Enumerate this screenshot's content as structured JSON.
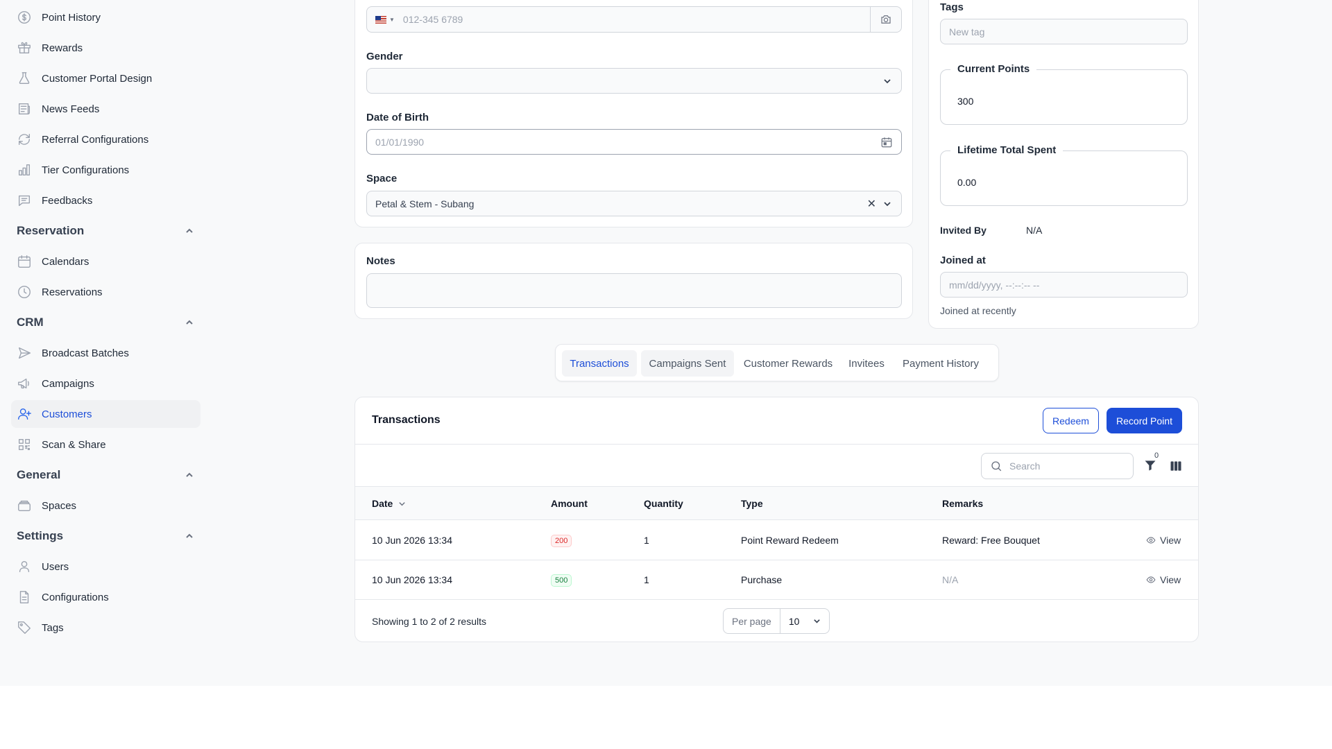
{
  "sidebar": {
    "items_top": [
      {
        "label": "Point History",
        "icon": "dollar-circle-icon"
      },
      {
        "label": "Rewards",
        "icon": "gift-icon"
      },
      {
        "label": "Customer Portal Design",
        "icon": "flask-icon"
      },
      {
        "label": "News Feeds",
        "icon": "newspaper-icon"
      },
      {
        "label": "Referral Configurations",
        "icon": "refresh-icon"
      },
      {
        "label": "Tier Configurations",
        "icon": "bar-chart-icon"
      },
      {
        "label": "Feedbacks",
        "icon": "chat-icon"
      }
    ],
    "groups": {
      "reservation": {
        "label": "Reservation",
        "items": [
          {
            "label": "Calendars"
          },
          {
            "label": "Reservations"
          }
        ]
      },
      "crm": {
        "label": "CRM",
        "items": [
          {
            "label": "Broadcast Batches"
          },
          {
            "label": "Campaigns"
          },
          {
            "label": "Customers"
          },
          {
            "label": "Scan & Share"
          }
        ]
      },
      "general": {
        "label": "General",
        "items": [
          {
            "label": "Spaces"
          }
        ]
      },
      "settings": {
        "label": "Settings",
        "items": [
          {
            "label": "Users"
          },
          {
            "label": "Configurations"
          },
          {
            "label": "Tags"
          }
        ]
      }
    },
    "active_item": "Customers"
  },
  "form": {
    "phone": {
      "placeholder": "012-345 6789",
      "country": "MY"
    },
    "gender": {
      "label": "Gender",
      "value": ""
    },
    "dob": {
      "label": "Date of Birth",
      "placeholder": "01/01/1990"
    },
    "space": {
      "label": "Space",
      "value": "Petal & Stem - Subang"
    },
    "notes": {
      "label": "Notes",
      "value": ""
    }
  },
  "side_panel": {
    "tags": {
      "label": "Tags",
      "placeholder": "New tag"
    },
    "current_points": {
      "label": "Current Points",
      "value": "300"
    },
    "lifetime_spent": {
      "label": "Lifetime Total Spent",
      "value": "0.00"
    },
    "invited_by": {
      "label": "Invited By",
      "value": "N/A"
    },
    "joined_at": {
      "label": "Joined at",
      "placeholder": "mm/dd/yyyy, --:--:-- --",
      "hint": "Joined at recently"
    }
  },
  "tabs": [
    "Transactions",
    "Campaigns Sent",
    "Customer Rewards",
    "Invitees",
    "Payment History"
  ],
  "active_tab": "Transactions",
  "transactions": {
    "title": "Transactions",
    "redeem_label": "Redeem",
    "record_label": "Record Point",
    "search_placeholder": "Search",
    "filter_count": "0",
    "columns": [
      "Date",
      "Amount",
      "Quantity",
      "Type",
      "Remarks"
    ],
    "rows": [
      {
        "date": "10 Jun 2026 13:34",
        "amount": "200",
        "amount_kind": "negative",
        "quantity": "1",
        "type": "Point Reward Redeem",
        "remarks": "Reward: Free Bouquet",
        "action": "View"
      },
      {
        "date": "10 Jun 2026 13:34",
        "amount": "500",
        "amount_kind": "positive",
        "quantity": "1",
        "type": "Purchase",
        "remarks": "N/A",
        "action": "View"
      }
    ],
    "summary": "Showing 1 to 2 of 2 results",
    "per_page_label": "Per page",
    "per_page_value": "10"
  },
  "colors": {
    "accent": "#1d4ed8",
    "negative": "#dc2626",
    "positive": "#15803d"
  }
}
